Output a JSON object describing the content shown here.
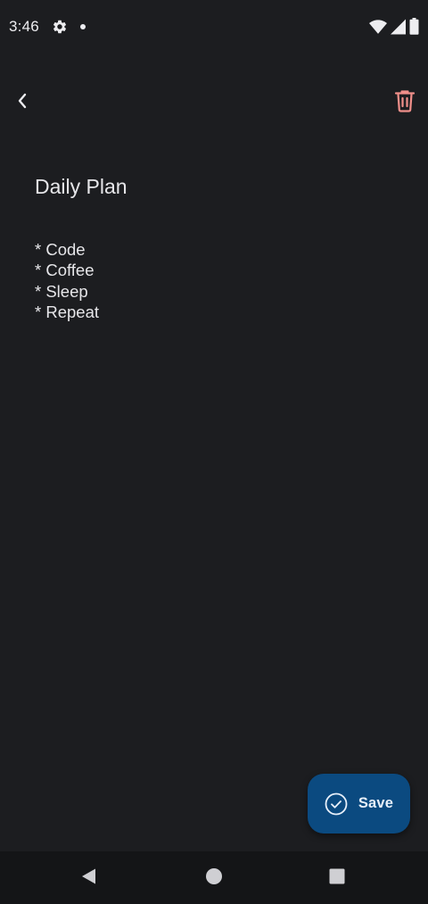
{
  "status_bar": {
    "time": "3:46",
    "icons": [
      "gear-icon",
      "notification-dot-icon",
      "wifi-icon",
      "signal-icon",
      "battery-icon"
    ]
  },
  "app_bar": {
    "back_icon": "chevron-left-icon",
    "delete_icon": "trash-icon",
    "delete_color": "#f08f8a"
  },
  "note": {
    "title": "Daily Plan",
    "lines": [
      "* Code",
      "* Coffee",
      "* Sleep",
      "* Repeat"
    ]
  },
  "save_button": {
    "label": "Save",
    "icon": "check-circle-icon",
    "color": "#0b4a80"
  },
  "navigation_bar": {
    "buttons": [
      "nav-back-icon",
      "nav-home-icon",
      "nav-recents-icon"
    ]
  }
}
